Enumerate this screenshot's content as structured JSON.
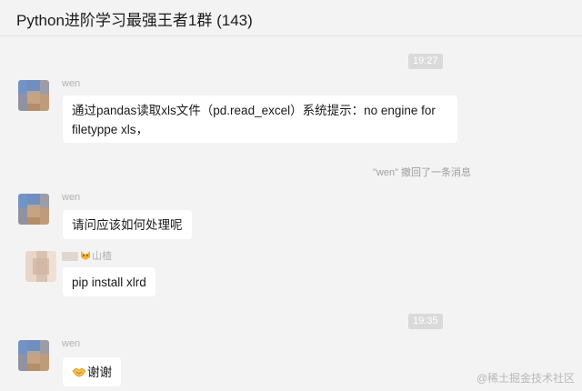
{
  "header": {
    "title": "Python进阶学习最强王者1群 (143)"
  },
  "timestamps": [
    "19:27",
    "19:35"
  ],
  "messages": [
    {
      "sender": "wen",
      "text": "通过pandas读取xls文件（pd.read_excel）系统提示：no engine for filetyppe xls，"
    },
    {
      "sender": "wen",
      "text": "请问应该如何处理呢"
    },
    {
      "sender": "山楂",
      "text": "pip install xlrd"
    },
    {
      "sender": "wen",
      "text": "谢谢",
      "emoji": "handshake-icon"
    }
  ],
  "system_notice": "\"wen\" 撤回了一条消息",
  "watermark": "@稀土掘金技术社区",
  "icons": {
    "sender_prefix": "cat-face-icon",
    "reaction": "handshake-icon"
  },
  "colors": {
    "background": "#f3f3f3",
    "bubble": "#ffffff",
    "timestamp_bg": "#dadada"
  }
}
